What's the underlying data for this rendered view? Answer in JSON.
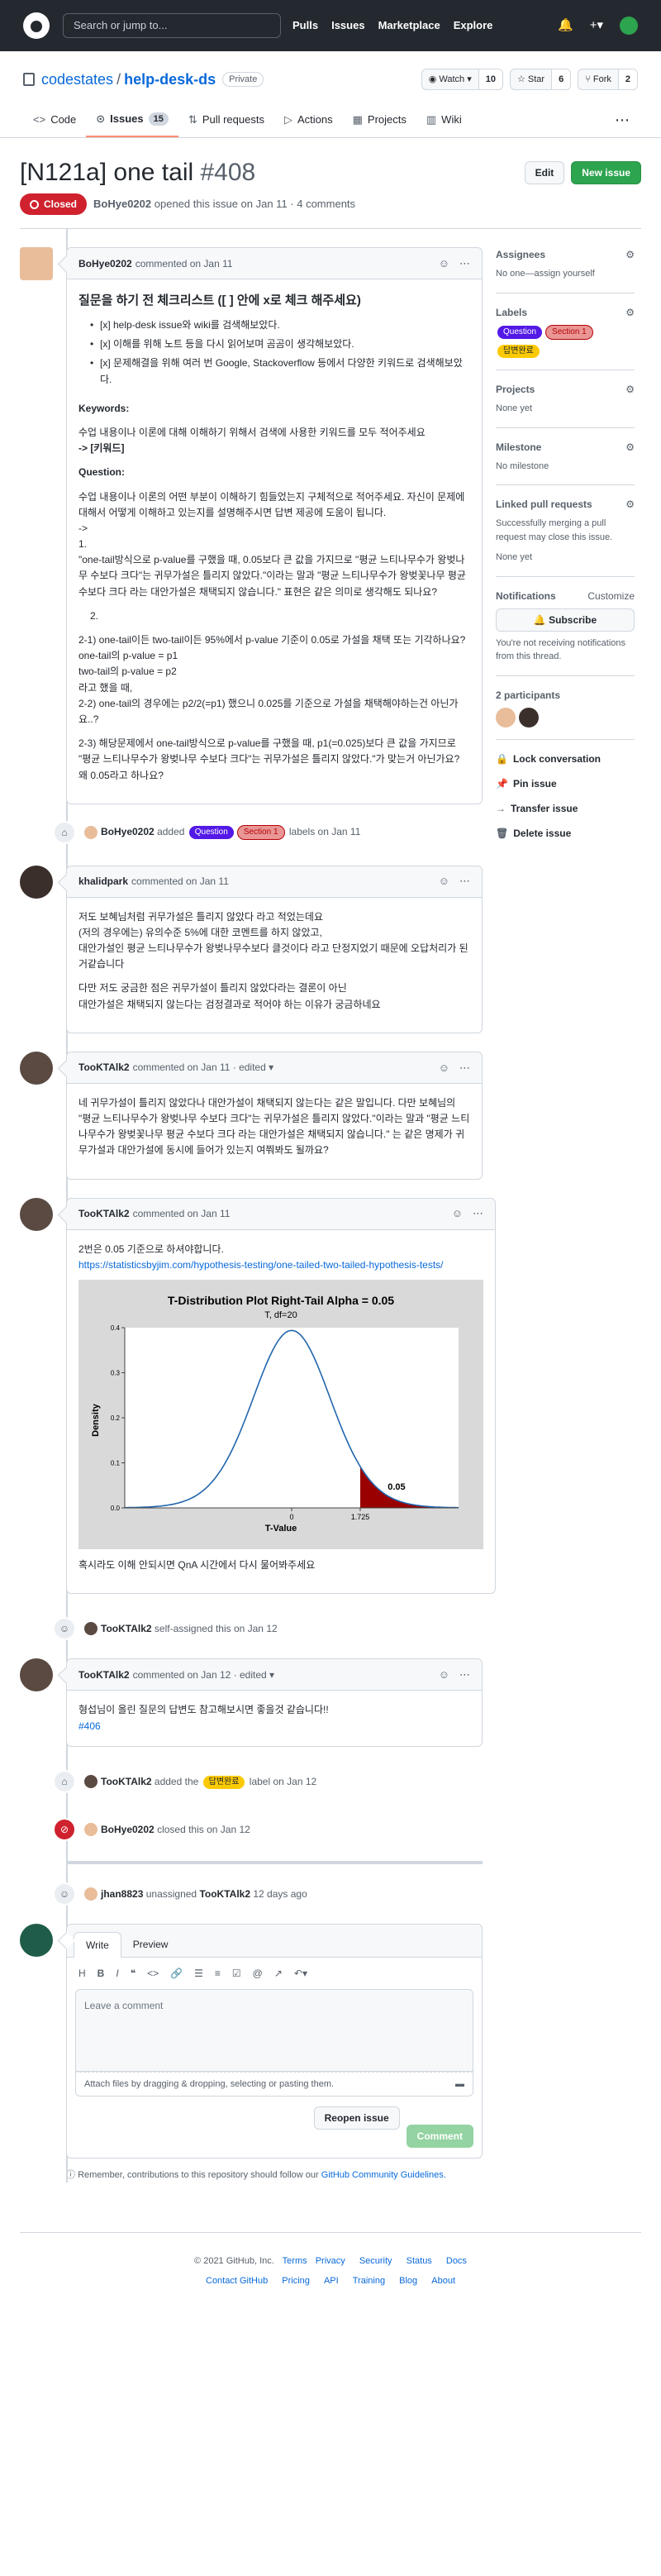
{
  "topbar": {
    "search_placeholder": "Search or jump to...",
    "nav": [
      "Pulls",
      "Issues",
      "Marketplace",
      "Explore"
    ]
  },
  "repo": {
    "owner": "codestates",
    "name": "help-desk-ds",
    "visibility": "Private",
    "watch_label": "Watch",
    "watch_count": "10",
    "star_label": "Star",
    "star_count": "6",
    "fork_label": "Fork",
    "fork_count": "2"
  },
  "tabs": [
    {
      "label": "Code"
    },
    {
      "label": "Issues",
      "count": "15"
    },
    {
      "label": "Pull requests"
    },
    {
      "label": "Actions"
    },
    {
      "label": "Projects"
    },
    {
      "label": "Wiki"
    }
  ],
  "issue": {
    "title": "[N121a] one tail",
    "number": "#408",
    "edit_label": "Edit",
    "new_label": "New issue",
    "state": "Closed",
    "author": "BoHye0202",
    "meta": "opened this issue on Jan 11 · 4 comments"
  },
  "comment1": {
    "author": "BoHye0202",
    "meta": "commented on Jan 11",
    "heading": "질문을 하기 전 체크리스트 ([ ] 안에 x로 체크 해주세요)",
    "checklist": [
      "[x] help-desk issue와 wiki를 검색해보았다.",
      "[x] 이해를 위해 노트 등을 다시 읽어보며 곰곰이 생각해보았다.",
      "[x] 문제해결을 위해 여러 번 Google, Stackoverflow 등에서 다양한 키워드로 검색해보았다."
    ],
    "keywords_h": "Keywords:",
    "keywords_text": "수업 내용이나 이론에 대해 이해하기 위해서 검색에 사용한 키워드를 모두 적어주세요",
    "keywords_tag": "-> [키워드]",
    "question_h": "Question:",
    "q1": "수업 내용이나 이론의 어떤 부분이 이해하기 힘들었는지 구체적으로 적어주세요. 자신이 문제에 대해서 어떻게 이해하고 있는지를 설명해주시면 답변 제공에 도움이 됩니다.\n->\n1.\n\"one-tail방식으로 p-value를 구했을 때, 0.05보다 큰 값을 가지므로 \"평균 느티나무수가 왕벚나무 수보다 크다\"는 귀무가설은 틀리지 않았다.\"이라는 말과 \"평균 느티나무수가 왕벚꽃나무 평균 수보다 크다 라는 대안가설은 채택되지 않습니다.\" 표현은 같은 의미로 생각해도 되나요?",
    "q2_num": "2.",
    "q3": "2-1) one-tail이든 two-tail이든 95%에서 p-value 기준이 0.05로 가설을 채택 또는 기각하나요?\none-tail의 p-value = p1\ntwo-tail의 p-value = p2\n라고 했을 때,\n2-2) one-tail의 경우에는 p2/2(=p1) 했으니 0.025를 기준으로 가설을 채택해야하는건 아닌가요..?",
    "q4": "2-3) 해당문제에서 one-tail방식으로 p-value를 구했을 때, p1(=0.025)보다 큰 값을 가지므로 \"평균 느티나무수가 왕벚나무 수보다 크다\"는 귀무가설은 틀리지 않았다.\"가 맞는거 아닌가요? 왜 0.05라고 하나요?"
  },
  "event_labels": {
    "author": "BoHye0202",
    "added": "added",
    "label_a": "Question",
    "label_b": "Section 1",
    "suffix": "labels on Jan 11"
  },
  "comment2": {
    "author": "khalidpark",
    "meta": "commented on Jan 11",
    "p1": "저도 보혜님처럼 귀무가설은 틀리지 않았다 라고 적었는데요\n(저의 경우에는) 유의수준 5%에 대한 코멘트를 하지 않았고,\n대안가설인 평균 느티나무수가 왕벚나무수보다 클것이다 라고 단정지었기 때문에 오답처리가 된거같습니다",
    "p2": "다만 저도 궁금한 점은 귀무가설이 틀리지 않았다라는 결론이 아닌\n대안가설은 채택되지 않는다는 검정결과로 적어야 하는 이유가 궁금하네요"
  },
  "comment3": {
    "author": "TooKTAlk2",
    "meta": "commented on Jan 11 · edited",
    "p1": "네 귀무가설이 틀리지 않았다나 대안가설이 채택되지 않는다는 같은 말입니다. 다만 보혜님의 \"평균 느티나무수가 왕벚나무 수보다 크다\"는 귀무가설은 틀리지 않았다.\"이라는 말과 \"평균 느티나무수가 왕벚꽃나무 평균 수보다 크다 라는 대안가설은 채택되지 않습니다.\" 는 같은 명제가 귀무가설과 대안가설에 동시에 들어가 있는지 여쭤봐도 될까요?"
  },
  "comment4": {
    "author": "TooKTAlk2",
    "meta": "commented on Jan 11",
    "p1": "2번은 0.05 기준으로 하셔야합니다.",
    "link": "https://statisticsbyjim.com/hypothesis-testing/one-tailed-two-tailed-hypothesis-tests/",
    "p2": "혹시라도 이해 안되시면 QnA 시간에서 다시 물어봐주세요"
  },
  "event_assign": {
    "author": "TooKTAlk2",
    "text": "self-assigned this on Jan 12"
  },
  "comment5": {
    "author": "TooKTAlk2",
    "meta": "commented on Jan 12 · edited",
    "p1": "형섭님이 올린 질문의 답변도 참고해보시면 좋을것 같습니다!!",
    "link": "#406"
  },
  "event_label2": {
    "author": "TooKTAlk2",
    "pre": "added the",
    "label": "답변완료",
    "post": "label on Jan 12"
  },
  "event_closed": {
    "author": "BoHye0202",
    "text": "closed this on Jan 12"
  },
  "event_unassign": {
    "author": "jhan8823",
    "text": "unassigned",
    "target": "TooKTAlk2",
    "time": "12 days ago"
  },
  "editor": {
    "write": "Write",
    "preview": "Preview",
    "placeholder": "Leave a comment",
    "attach": "Attach files by dragging & dropping, selecting or pasting them.",
    "reopen": "Reopen issue",
    "comment": "Comment"
  },
  "note": {
    "text": "Remember, contributions to this repository should follow our",
    "link": "GitHub Community Guidelines."
  },
  "sidebar": {
    "assignees_h": "Assignees",
    "assignees_v": "No one—assign yourself",
    "labels_h": "Labels",
    "labels": [
      "Question",
      "Section 1",
      "답변완료"
    ],
    "projects_h": "Projects",
    "projects_v": "None yet",
    "milestone_h": "Milestone",
    "milestone_v": "No milestone",
    "linked_h": "Linked pull requests",
    "linked_t": "Successfully merging a pull request may close this issue.",
    "linked_v": "None yet",
    "notif_h": "Notifications",
    "notif_customize": "Customize",
    "subscribe": "Subscribe",
    "notif_t": "You're not receiving notifications from this thread.",
    "participants_h": "2 participants",
    "actions": [
      "Lock conversation",
      "Pin issue",
      "Transfer issue",
      "Delete issue"
    ]
  },
  "chart_data": {
    "type": "area",
    "title": "T-Distribution Plot Right-Tail Alpha = 0.05",
    "subtitle": "T, df=20",
    "xlabel": "T-Value",
    "ylabel": "Density",
    "ylim": [
      0,
      0.4
    ],
    "y_ticks": [
      "0.0",
      "0.1",
      "0.2",
      "0.3",
      "0.4"
    ],
    "x_ticks": [
      "0",
      "1.725"
    ],
    "annotation": "0.05",
    "df": 20,
    "critical_value": 1.725,
    "colors": {
      "curve": "#2166ac",
      "shade": "#990000"
    }
  },
  "footer": {
    "copyright": "© 2021 GitHub, Inc.",
    "row1": [
      "Terms",
      "Privacy",
      "Security",
      "Status",
      "Docs"
    ],
    "row2": [
      "Contact GitHub",
      "Pricing",
      "API",
      "Training",
      "Blog",
      "About"
    ]
  }
}
